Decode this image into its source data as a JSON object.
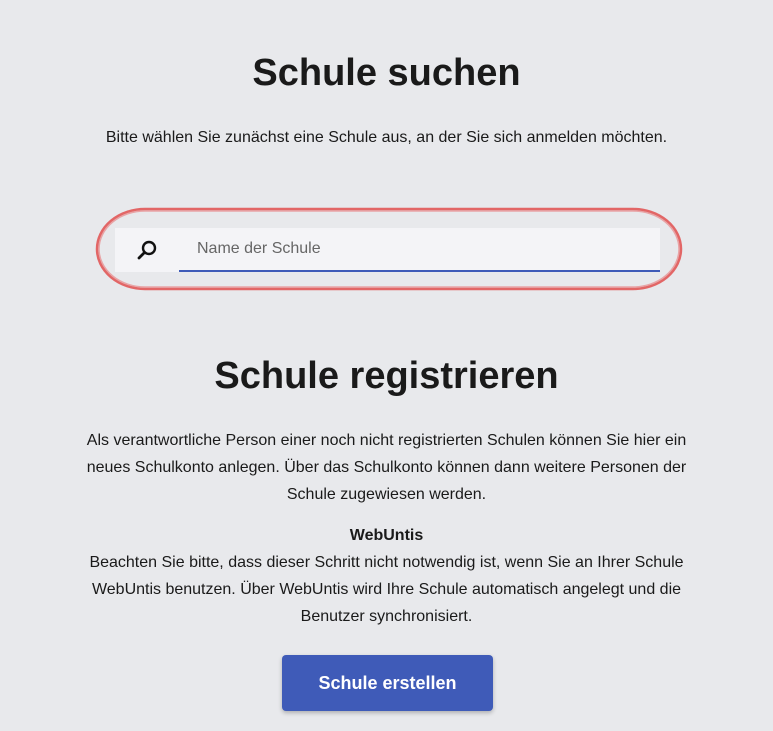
{
  "search_section": {
    "title": "Schule suchen",
    "subtitle": "Bitte wählen Sie zunächst eine Schule aus, an der Sie sich anmelden möchten.",
    "input": {
      "placeholder": "Name der Schule",
      "value": ""
    },
    "icon": "search-icon"
  },
  "register_section": {
    "title": "Schule registrieren",
    "description": "Als verantwortliche Person einer noch nicht registrierten Schulen können Sie hier ein neues Schulkonto anlegen. Über das Schulkonto können dann weitere Personen der Schule zugewiesen werden.",
    "webuntis_title": "WebUntis",
    "webuntis_text": "Beachten Sie bitte, dass dieser Schritt nicht notwendig ist, wenn Sie an Ihrer Schule WebUntis benutzen. Über WebUntis wird Ihre Schule automatisch angelegt und die Benutzer synchronisiert.",
    "button_label": "Schule erstellen"
  },
  "colors": {
    "background": "#e8e9ec",
    "accent": "#3f5bb8",
    "highlight": "#e03a3a"
  }
}
